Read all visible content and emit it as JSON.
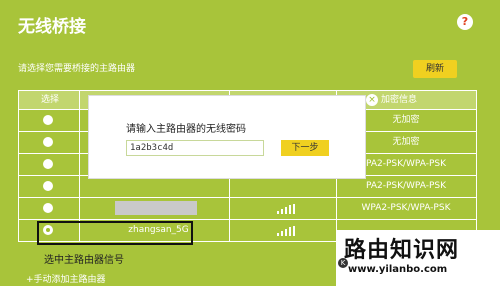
{
  "header": {
    "title": "无线桥接",
    "help_icon": "?"
  },
  "instruction": "请选择您需要桥接的主路由器",
  "refresh_label": "刷新",
  "table": {
    "headers": {
      "select": "选择",
      "security": "加密信息"
    },
    "rows": [
      {
        "ssid": "",
        "security": "无加密",
        "selected": false
      },
      {
        "ssid": "",
        "security": "无加密",
        "selected": false
      },
      {
        "ssid": "",
        "security": "PA2-PSK/WPA-PSK",
        "selected": false
      },
      {
        "ssid": "",
        "security": "PA2-PSK/WPA-PSK",
        "selected": false
      },
      {
        "ssid": "",
        "security": "WPA2-PSK/WPA-PSK",
        "selected": false
      },
      {
        "ssid": "zhangsan_5G",
        "security": "",
        "selected": true
      }
    ]
  },
  "selected_caption": "选中主路由器信号",
  "add_link": "+手动添加主路由器",
  "modal": {
    "label": "请输入主路由器的无线密码",
    "password_value": "1a2b3c4d",
    "next_label": "下一步",
    "close_icon": "×"
  },
  "watermark": {
    "main": "路由知识网",
    "url": "www.yilanbo.com",
    "k_icon": "K"
  },
  "colors": {
    "background": "#a8c43a",
    "button": "#f0d020"
  }
}
